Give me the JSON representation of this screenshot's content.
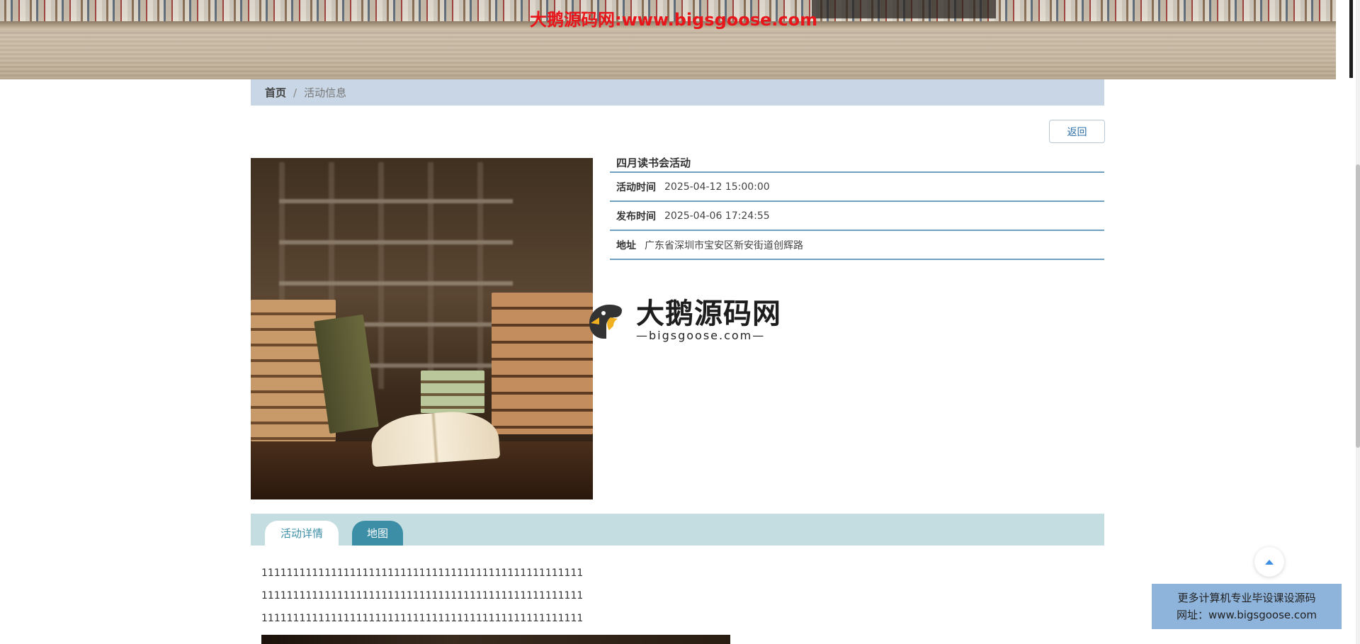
{
  "banner": {
    "watermark": "大鹅源码网:www.bigsgoose.com"
  },
  "breadcrumb": {
    "home": "首页",
    "separator": "/",
    "current": "活动信息"
  },
  "actions": {
    "back_label": "返回"
  },
  "activity": {
    "title": "四月读书会活动",
    "fields": [
      {
        "label": "活动时间",
        "value": "2025-04-12 15:00:00"
      },
      {
        "label": "发布时间",
        "value": "2025-04-06 17:24:55"
      },
      {
        "label": "地址",
        "value": "广东省深圳市宝安区新安街道创辉路"
      }
    ]
  },
  "logo": {
    "title": "大鹅源码网",
    "subtitle": "—bigsgoose.com—"
  },
  "tabs": [
    {
      "label": "活动详情",
      "active": false
    },
    {
      "label": "地图",
      "active": true
    }
  ],
  "detail": {
    "lines": [
      "111111111111111111111111111111111111111111111111111",
      "111111111111111111111111111111111111111111111111111",
      "111111111111111111111111111111111111111111111111111"
    ]
  },
  "promo": {
    "line1": "更多计算机专业毕设课设源码",
    "line2": "网址：www.bigsgoose.com"
  },
  "colors": {
    "watermark_red": "#e8151b",
    "breadcrumb_bg": "#c9d6e5",
    "tab_bar_bg": "#c3dde1",
    "tab_active": "#3c8ea6",
    "info_border": "#6fa0c0",
    "promo_bg": "#8fb4dc"
  },
  "icons": {
    "to_top": "chevron-up-icon"
  }
}
